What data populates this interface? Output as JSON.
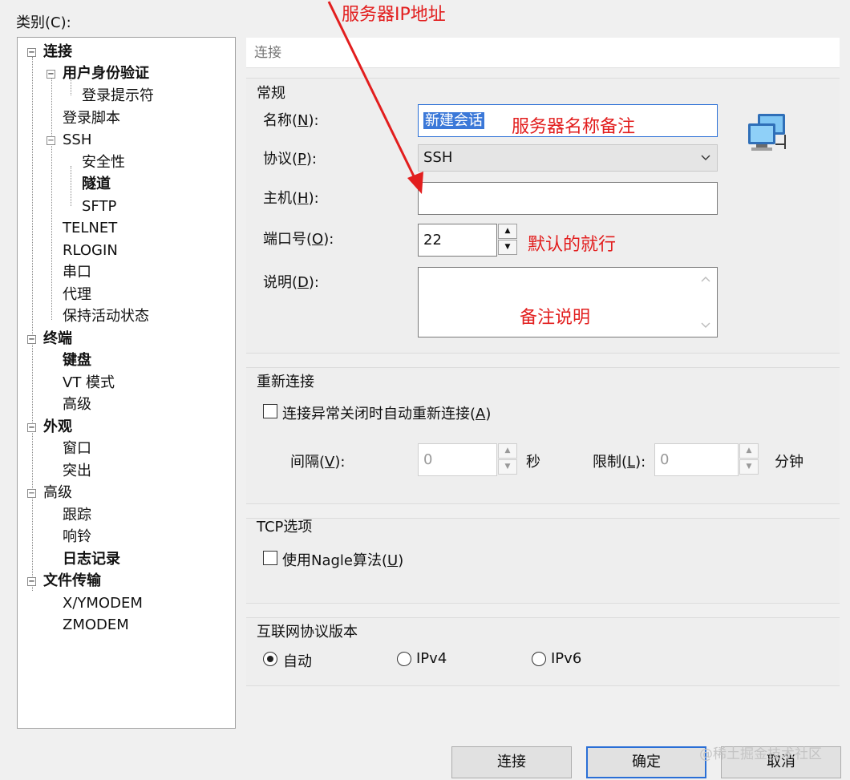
{
  "category_label": "类别(C):",
  "tree": [
    {
      "label": "连接",
      "bold": true
    },
    {
      "label": "用户身份验证",
      "bold": true
    },
    {
      "label": "登录提示符"
    },
    {
      "label": "登录脚本"
    },
    {
      "label": "SSH"
    },
    {
      "label": "安全性"
    },
    {
      "label": "隧道",
      "bold": true
    },
    {
      "label": "SFTP"
    },
    {
      "label": "TELNET"
    },
    {
      "label": "RLOGIN"
    },
    {
      "label": "串口"
    },
    {
      "label": "代理"
    },
    {
      "label": "保持活动状态"
    },
    {
      "label": "终端",
      "bold": true
    },
    {
      "label": "键盘",
      "bold": true
    },
    {
      "label": "VT 模式"
    },
    {
      "label": "高级"
    },
    {
      "label": "外观",
      "bold": true
    },
    {
      "label": "窗口"
    },
    {
      "label": "突出"
    },
    {
      "label": "高级"
    },
    {
      "label": "跟踪"
    },
    {
      "label": "响铃"
    },
    {
      "label": "日志记录",
      "bold": true
    },
    {
      "label": "文件传输",
      "bold": true
    },
    {
      "label": "X/YMODEM"
    },
    {
      "label": "ZMODEM"
    }
  ],
  "header": "连接",
  "general": {
    "title": "常规",
    "name_label": "名称",
    "name_key": "N",
    "name_value": "新建会话",
    "protocol_label": "协议",
    "protocol_key": "P",
    "protocol_value": "SSH",
    "host_label": "主机",
    "host_key": "H",
    "host_value": "",
    "port_label": "端口号",
    "port_key": "O",
    "port_value": "22",
    "desc_label": "说明",
    "desc_key": "D",
    "desc_value": ""
  },
  "reconnect": {
    "title": "重新连接",
    "checkbox_label": "连接异常关闭时自动重新连接",
    "checkbox_key": "A",
    "checked": false,
    "interval_label": "间隔",
    "interval_key": "V",
    "interval_value": "0",
    "interval_unit": "秒",
    "limit_label": "限制",
    "limit_key": "L",
    "limit_value": "0",
    "limit_unit": "分钟"
  },
  "tcp": {
    "title": "TCP选项",
    "nagle_label": "使用Nagle算法",
    "nagle_key": "U",
    "checked": false
  },
  "ip_version": {
    "title": "互联网协议版本",
    "options": [
      "自动",
      "IPv4",
      "IPv6"
    ],
    "selected": "自动"
  },
  "buttons": {
    "connect": "连接",
    "ok": "确定",
    "cancel": "取消"
  },
  "annotations": {
    "host_ip": "服务器IP地址",
    "name_note": "服务器名称备注",
    "port_note": "默认的就行",
    "desc_note": "备注说明"
  },
  "watermark": "@稀土掘金技术社区",
  "colors": {
    "annotation": "#e21e1e",
    "selection": "#3b78d8",
    "default_button_border": "#2a6fd6"
  }
}
